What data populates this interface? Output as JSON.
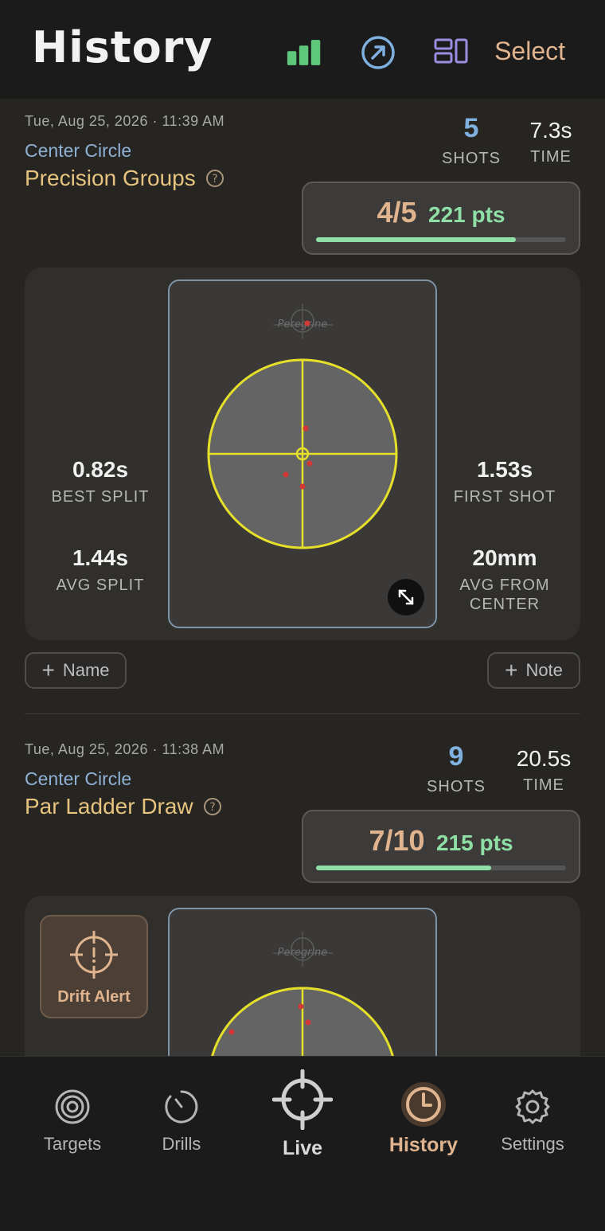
{
  "header": {
    "title": "History",
    "select_label": "Select",
    "icons": [
      "bar-chart-icon",
      "share-arrow-icon",
      "layout-icon"
    ]
  },
  "colors": {
    "accent": "#e0b48e",
    "green": "#8fe0a6",
    "blue": "#7fb0e0",
    "gold": "#e6c37e",
    "shot": "#d23838",
    "ring": "#e6e02a"
  },
  "sessions": [
    {
      "date": "Tue, Aug 25, 2026 · 11:39 AM",
      "target": "Center Circle",
      "drill": "Precision Groups",
      "shots": "5",
      "shots_label": "SHOTS",
      "time": "7.3s",
      "time_label": "TIME",
      "score": "4/5",
      "points": "221 pts",
      "progress": 0.8,
      "best_split": "0.82s",
      "best_split_label": "BEST SPLIT",
      "avg_split": "1.44s",
      "avg_split_label": "AVG SPLIT",
      "first_shot": "1.53s",
      "first_shot_label": "FIRST SHOT",
      "avg_center": "20mm",
      "avg_center_label": "AVG FROM CENTER",
      "name_btn": "Name",
      "note_btn": "Note",
      "watermark": "Peregrine"
    },
    {
      "date": "Tue, Aug 25, 2026 · 11:38 AM",
      "target": "Center Circle",
      "drill": "Par Ladder Draw",
      "shots": "9",
      "shots_label": "SHOTS",
      "time": "20.5s",
      "time_label": "TIME",
      "score": "7/10",
      "points": "215 pts",
      "progress": 0.7,
      "drift_alert": "Drift Alert",
      "watermark": "Peregrine"
    }
  ],
  "tabs": [
    {
      "label": "Targets",
      "icon": "target-rings-icon",
      "active": false
    },
    {
      "label": "Drills",
      "icon": "stopwatch-icon",
      "active": false
    },
    {
      "label": "Live",
      "icon": "crosshair-icon",
      "active": false
    },
    {
      "label": "History",
      "icon": "clock-icon",
      "active": true
    },
    {
      "label": "Settings",
      "icon": "gear-icon",
      "active": false
    }
  ]
}
